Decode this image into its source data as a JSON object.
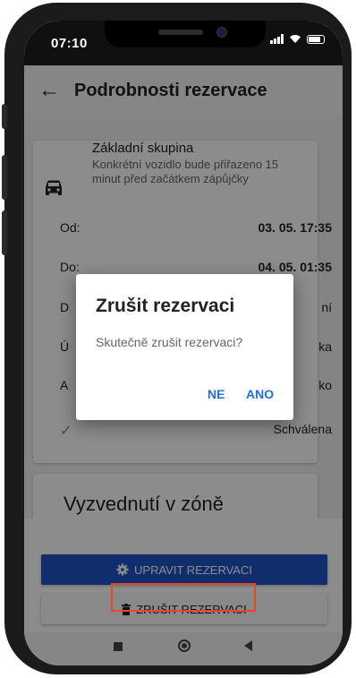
{
  "status_bar": {
    "time": "07:10"
  },
  "app_bar": {
    "title": "Podrobnosti rezervace",
    "back_glyph": "←"
  },
  "vehicle": {
    "group": "Základní skupina",
    "description": "Konkrétní vozidlo bude přiřazeno 15 minut před začátkem zápůjčky"
  },
  "details": [
    {
      "label": "Od:",
      "value": "03. 05. 17:35"
    },
    {
      "label": "Do:",
      "value": "04. 05. 01:35"
    },
    {
      "label": "D",
      "value": "ní"
    },
    {
      "label": "Ú",
      "value": "ka"
    },
    {
      "label": "A",
      "value": "ko"
    },
    {
      "label": "✓",
      "value": "Schválena"
    }
  ],
  "pickup": {
    "title": "Vyzvednutí v zóně"
  },
  "buttons": {
    "edit": "UPRAVIT REZERVACI",
    "cancel": "ZRUŠIT REZERVACI"
  },
  "dialog": {
    "title": "Zrušit rezervaci",
    "message": "Skutečně zrušit rezervaci?",
    "no": "NE",
    "yes": "ANO"
  },
  "colors": {
    "accent": "#1e55c8",
    "dialog_button": "#1e6fd9",
    "highlight": "#e8452c",
    "approved": "#4caf50"
  },
  "icons": [
    "car-icon",
    "gear-icon",
    "trash-icon",
    "back-arrow-icon"
  ]
}
